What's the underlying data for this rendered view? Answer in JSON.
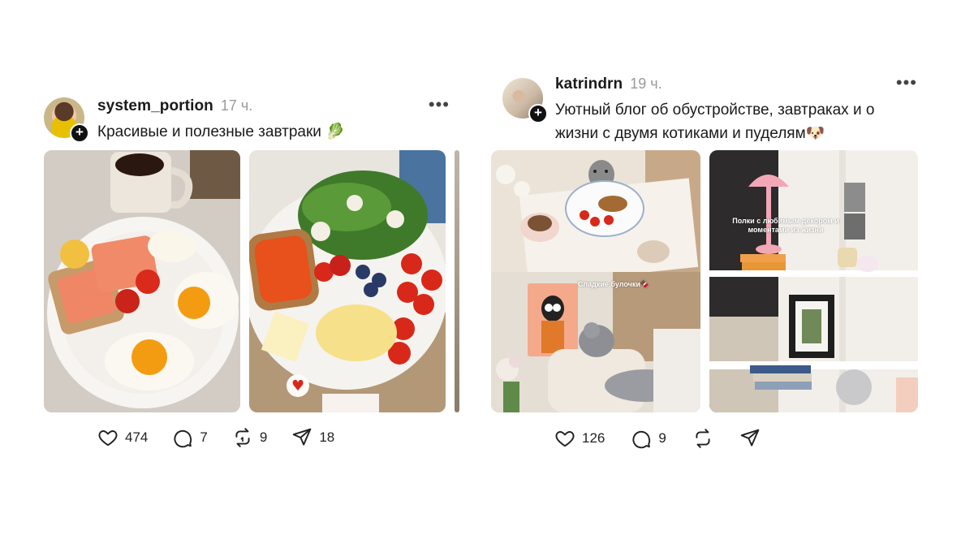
{
  "posts": [
    {
      "username": "system_portion",
      "time": "17 ч.",
      "caption": "Красивые и полезные завтраки 🥬",
      "likes": "474",
      "comments": "7",
      "reposts": "9",
      "shares": "18",
      "images": [
        "breakfast-photo-1",
        "breakfast-photo-2",
        "breakfast-photo-3-partial"
      ]
    },
    {
      "username": "katrindrn",
      "time": "19 ч.",
      "caption_line1": "Уютный блог об обустройстве, завтраках и о",
      "caption_line2": "жизни с двумя котиками и пуделям🐶",
      "likes": "126",
      "comments": "9",
      "collage_overlay": "Сладкие булочки🍫",
      "shelf_overlay_1": "Полки с любимым декором и",
      "shelf_overlay_2": "моментами из жизни"
    }
  ],
  "icons": {
    "more": "more-horizontal-icon",
    "follow": "plus-icon",
    "like": "heart-icon",
    "comment": "comment-icon",
    "repost": "repost-icon",
    "share": "send-icon"
  },
  "colors": {
    "text": "#1a1a1a",
    "muted": "#9a9a9a",
    "badge": "#111111"
  }
}
